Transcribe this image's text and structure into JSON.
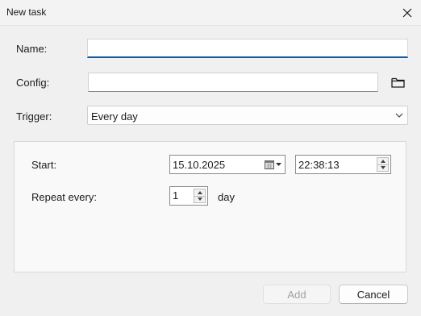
{
  "window": {
    "title": "New task"
  },
  "form": {
    "name_label": "Name:",
    "name_value": "",
    "config_label": "Config:",
    "config_value": "",
    "trigger_label": "Trigger:",
    "trigger_value": "Every day"
  },
  "schedule": {
    "start_label": "Start:",
    "start_date": "15.10.2025",
    "start_time": "22:38:13",
    "repeat_label": "Repeat every:",
    "repeat_value": "1",
    "repeat_unit": "day"
  },
  "buttons": {
    "add_label": "Add",
    "cancel_label": "Cancel"
  },
  "icons": {
    "close": "close-icon",
    "folder": "folder-icon",
    "dropdown": "chevron-down-icon",
    "calendar": "calendar-icon"
  },
  "colors": {
    "focus_accent": "#005fb8",
    "window_bg": "#f0f0f0"
  }
}
